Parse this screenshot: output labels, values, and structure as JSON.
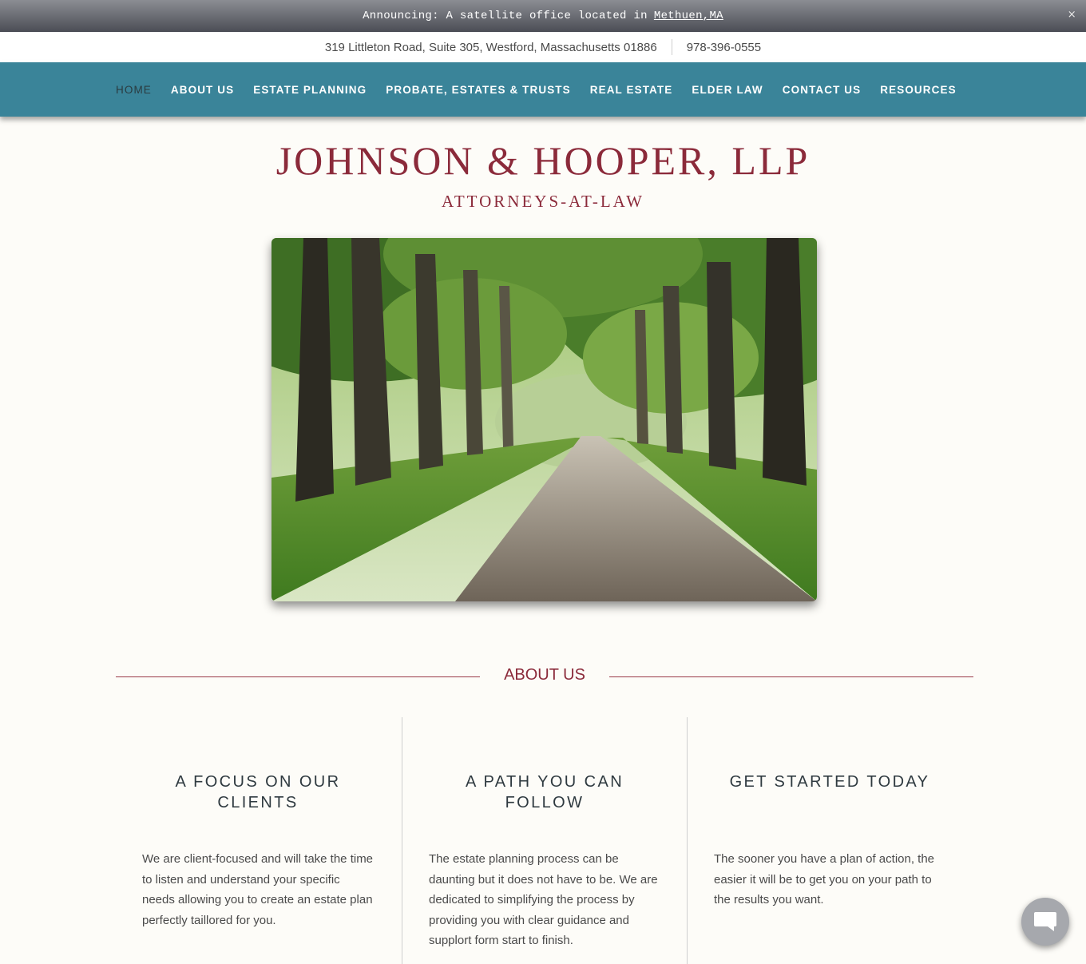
{
  "announcement": {
    "text": "Announcing: A satellite office located in",
    "link_label": "Methuen,MA",
    "close_label": "×"
  },
  "contact": {
    "address": "319 Littleton Road, Suite 305, Westford, Massachusetts 01886",
    "phone": "978-396-0555"
  },
  "nav": {
    "items": [
      {
        "label": "HOME",
        "active": true
      },
      {
        "label": "ABOUT US"
      },
      {
        "label": "ESTATE PLANNING"
      },
      {
        "label": "PROBATE, ESTATES & TRUSTS"
      },
      {
        "label": "REAL ESTATE"
      },
      {
        "label": "ELDER LAW"
      },
      {
        "label": "CONTACT US"
      },
      {
        "label": "RESOURCES"
      }
    ]
  },
  "brand": {
    "title": "JOHNSON & HOOPER, LLP",
    "subtitle": "ATTORNEYS-AT-LAW",
    "color": "#8b2a3a"
  },
  "hero": {
    "image": "tree-lined-path-photo"
  },
  "about": {
    "heading": "ABOUT US",
    "columns": [
      {
        "title": "A FOCUS ON OUR CLIENTS",
        "text": "We are client-focused and will take the time to listen and understand your specific needs allowing you to create an estate plan perfectly taillored for you."
      },
      {
        "title": "A PATH YOU CAN FOLLOW",
        "text": "The estate planning process can be daunting but it does not have to be. We are dedicated to simplifying the process by providing you with clear guidance and supplort form start to finish."
      },
      {
        "title": "GET STARTED TODAY",
        "text": "The sooner you have a plan of action, the easier it will be to get you on your path to the results you want."
      }
    ]
  },
  "chat": {
    "icon": "chat-bubble-icon"
  },
  "colors": {
    "nav_bg": "#3a8499",
    "accent": "#8b2a3a",
    "page_bg": "#fdfcf8"
  }
}
